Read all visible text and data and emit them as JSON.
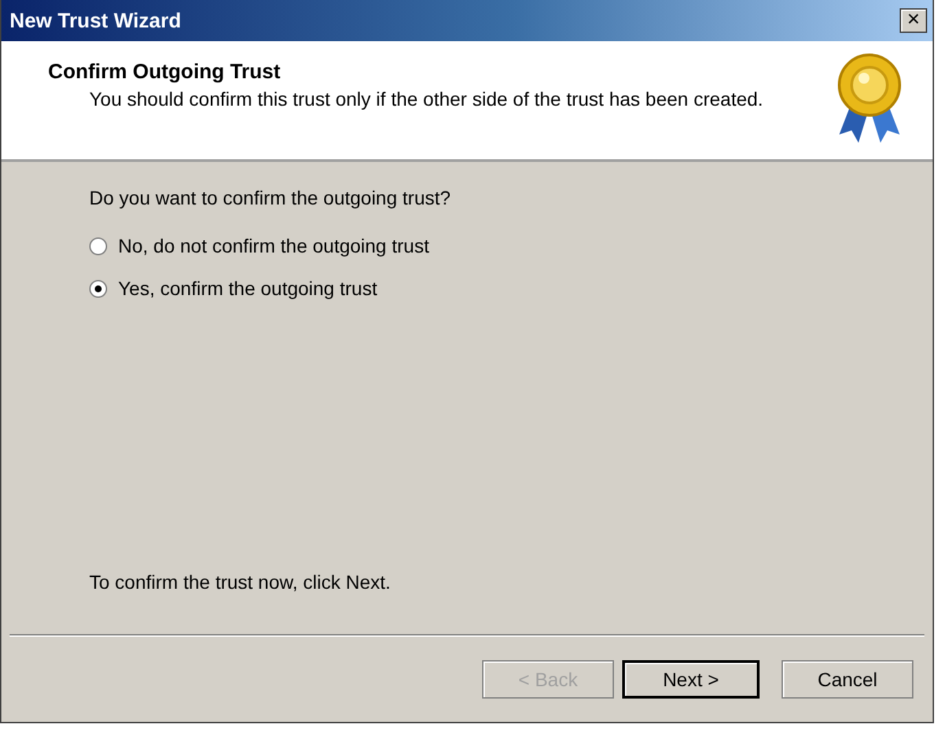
{
  "window": {
    "title": "New Trust Wizard",
    "close": "×"
  },
  "header": {
    "title": "Confirm Outgoing Trust",
    "subtitle": "You should confirm this trust only if the other side of the trust has been created."
  },
  "question": "Do you want to confirm the outgoing trust?",
  "options": [
    {
      "label": "No, do not confirm the outgoing trust",
      "selected": false
    },
    {
      "label": "Yes, confirm the outgoing trust",
      "selected": true
    }
  ],
  "hint": "To confirm the trust now, click Next.",
  "buttons": [
    {
      "label": "< Back",
      "disabled": true,
      "default": false
    },
    {
      "label": "Next >",
      "disabled": false,
      "default": true
    },
    {
      "label": "Cancel",
      "disabled": false,
      "default": false
    }
  ]
}
